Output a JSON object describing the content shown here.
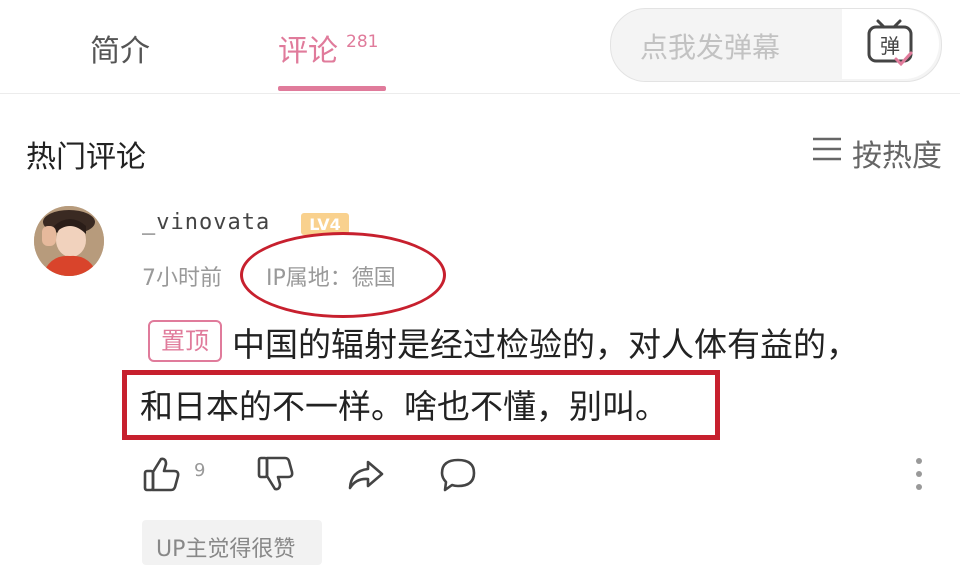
{
  "tabs": {
    "intro_label": "简介",
    "comments_label": "评论",
    "comments_count": "281"
  },
  "danmaku": {
    "placeholder": "点我发弹幕",
    "button_icon": "danmaku-tv-icon",
    "button_glyph": "弹"
  },
  "hot_comments": {
    "title": "热门评论",
    "sort_label": "按热度",
    "sort_icon": "menu-lines-icon"
  },
  "comment": {
    "username": "_vinovata",
    "level_badge": "LV4",
    "time": "7小时前",
    "ip_location": "IP属地：德国",
    "pinned_label": "置顶",
    "text_line1": "中国的辐射是经过检验的，对人体有益的，",
    "text_line2": "和日本的不一样。啥也不懂，别叫。",
    "like_count": "9",
    "up_liked_label": "UP主觉得很赞"
  },
  "colors": {
    "accent_pink": "#e07b9b",
    "annotation_red": "#c7202e",
    "muted_text": "#999999"
  },
  "icons": {
    "like": "thumbs-up-icon",
    "dislike": "thumbs-down-icon",
    "share": "share-arrow-icon",
    "reply": "comment-bubble-icon",
    "more": "more-vertical-icon"
  }
}
